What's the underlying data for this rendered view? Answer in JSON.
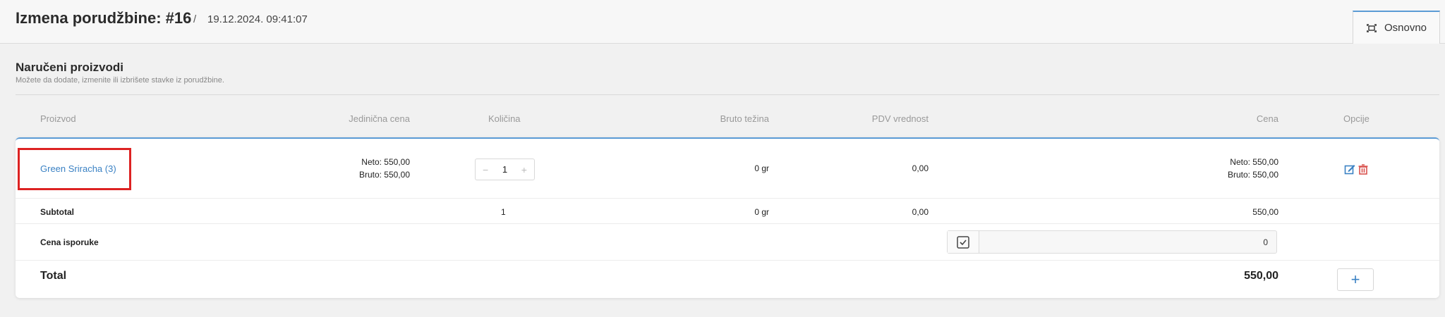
{
  "header": {
    "title": "Izmena porudžbine: #16",
    "separator": "/",
    "date": "19.12.2024. 09:41:07",
    "tab_label": "Osnovno"
  },
  "section": {
    "title": "Naručeni proizvodi",
    "subtitle": "Možete da dodate, izmenite ili izbrišete stavke iz porudžbine."
  },
  "columns": {
    "product": "Proizvod",
    "unit_price": "Jedinična cena",
    "quantity": "Količina",
    "gross_weight": "Bruto težina",
    "vat": "PDV vrednost",
    "price": "Cena",
    "options": "Opcije"
  },
  "items": [
    {
      "name": "Green Sriracha (3)",
      "unit_net": "Neto: 550,00",
      "unit_gross": "Bruto: 550,00",
      "qty_minus": "−",
      "qty": "1",
      "qty_plus": "+",
      "weight": "0 gr",
      "vat": "0,00",
      "price_net": "Neto: 550,00",
      "price_gross": "Bruto: 550,00"
    }
  ],
  "subtotal": {
    "label": "Subtotal",
    "qty": "1",
    "weight": "0 gr",
    "vat": "0,00",
    "price": "550,00"
  },
  "shipping": {
    "label": "Cena isporuke",
    "value": "0"
  },
  "total": {
    "label": "Total",
    "value": "550,00",
    "add_symbol": "+"
  },
  "colors": {
    "accent": "#5b9bd5",
    "link": "#3b82c4",
    "delete": "#d9534f",
    "highlight": "#dd2222"
  }
}
